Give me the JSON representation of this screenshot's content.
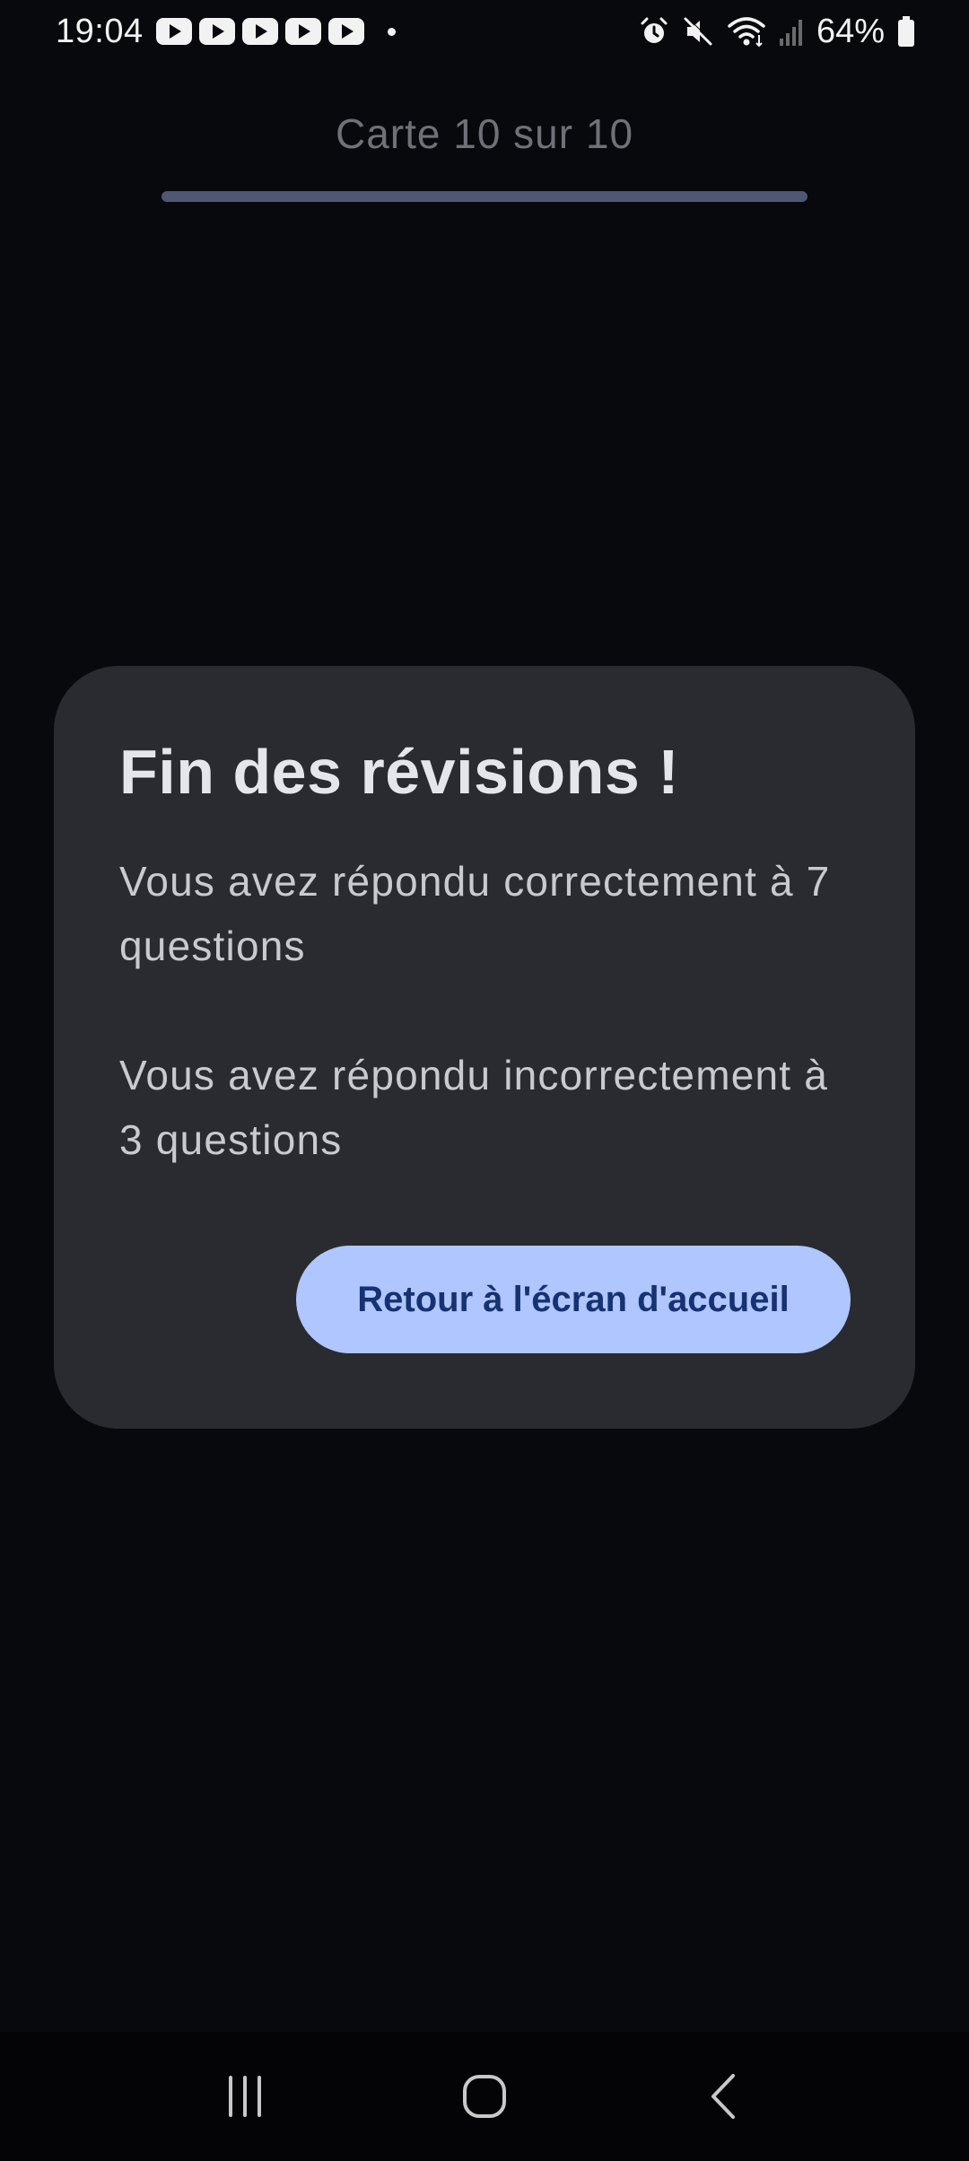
{
  "status_bar": {
    "time": "19:04",
    "battery_percent": "64%",
    "notification_icons": [
      "youtube-icon",
      "youtube-icon",
      "youtube-icon",
      "youtube-icon",
      "youtube-icon"
    ],
    "system_icons": [
      "alarm-icon",
      "mute-icon",
      "wifi-icon",
      "signal-icon",
      "battery-icon"
    ]
  },
  "progress": {
    "label": "Carte 10 sur 10",
    "fraction": 1.0
  },
  "dialog": {
    "title": "Fin des révisions !",
    "correct_text": "Vous avez répondu correctement à 7 questions",
    "incorrect_text": "Vous avez répondu incorrectement à 3 questions",
    "home_button_label": "Retour à l'écran d'accueil"
  },
  "nav_bar": {
    "buttons": [
      "recents-icon",
      "home-icon",
      "back-icon"
    ]
  },
  "colors": {
    "background": "#08090c",
    "dialog_bg": "#2a2b30",
    "button_bg": "#afc6ff",
    "button_text": "#173273",
    "progress_fill": "#4f5872"
  }
}
